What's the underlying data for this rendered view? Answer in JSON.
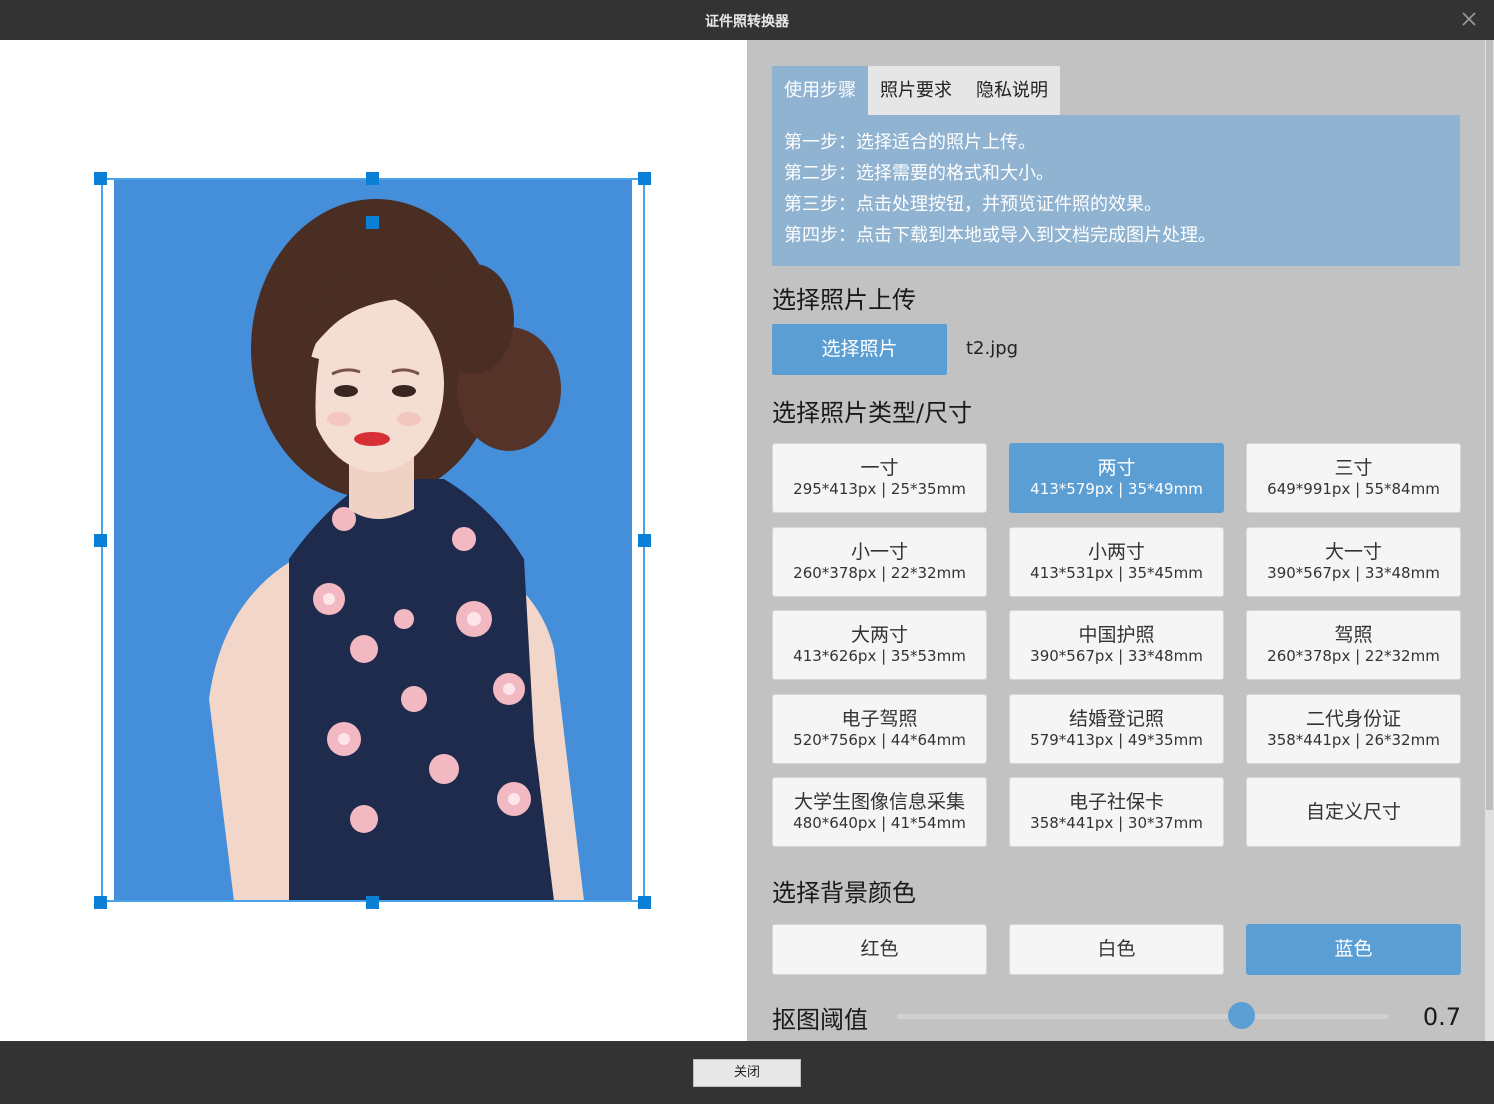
{
  "window": {
    "title": "证件照转换器",
    "close_icon": "close-icon"
  },
  "tabs": [
    {
      "label": "使用步骤",
      "active": true
    },
    {
      "label": "照片要求",
      "active": false
    },
    {
      "label": "隐私说明",
      "active": false
    }
  ],
  "steps": [
    "第一步：选择适合的照片上传。",
    "第二步：选择需要的格式和大小。",
    "第三步：点击处理按钮，并预览证件照的效果。",
    "第四步：点击下载到本地或导入到文档完成图片处理。"
  ],
  "upload": {
    "heading": "选择照片上传",
    "button_label": "选择照片",
    "filename": "t2.jpg"
  },
  "sizes": {
    "heading": "选择照片类型/尺寸",
    "items": [
      {
        "name": "一寸",
        "dims": "295*413px | 25*35mm",
        "selected": false
      },
      {
        "name": "两寸",
        "dims": "413*579px | 35*49mm",
        "selected": true
      },
      {
        "name": "三寸",
        "dims": "649*991px | 55*84mm",
        "selected": false
      },
      {
        "name": "小一寸",
        "dims": "260*378px | 22*32mm",
        "selected": false
      },
      {
        "name": "小两寸",
        "dims": "413*531px | 35*45mm",
        "selected": false
      },
      {
        "name": "大一寸",
        "dims": "390*567px | 33*48mm",
        "selected": false
      },
      {
        "name": "大两寸",
        "dims": "413*626px | 35*53mm",
        "selected": false
      },
      {
        "name": "中国护照",
        "dims": "390*567px | 33*48mm",
        "selected": false
      },
      {
        "name": "驾照",
        "dims": "260*378px | 22*32mm",
        "selected": false
      },
      {
        "name": "电子驾照",
        "dims": "520*756px | 44*64mm",
        "selected": false
      },
      {
        "name": "结婚登记照",
        "dims": "579*413px | 49*35mm",
        "selected": false
      },
      {
        "name": "二代身份证",
        "dims": "358*441px | 26*32mm",
        "selected": false
      },
      {
        "name": "大学生图像信息采集",
        "dims": "480*640px | 41*54mm",
        "selected": false
      },
      {
        "name": "电子社保卡",
        "dims": "358*441px | 30*37mm",
        "selected": false
      },
      {
        "name": "自定义尺寸",
        "dims": "",
        "selected": false
      }
    ]
  },
  "background": {
    "heading": "选择背景颜色",
    "options": [
      {
        "label": "红色",
        "selected": false
      },
      {
        "label": "白色",
        "selected": false
      },
      {
        "label": "蓝色",
        "selected": true
      }
    ],
    "photo_bg_color": "#458ed9"
  },
  "threshold": {
    "label": "抠图阈值",
    "value": "0.7",
    "fraction": 0.7
  },
  "footer": {
    "close_label": "关闭"
  },
  "colors": {
    "accent": "#5b9ed4",
    "tab_active": "#8fb3d0",
    "panel_bg": "#c2c2c2",
    "handle": "#0a7fd6"
  }
}
